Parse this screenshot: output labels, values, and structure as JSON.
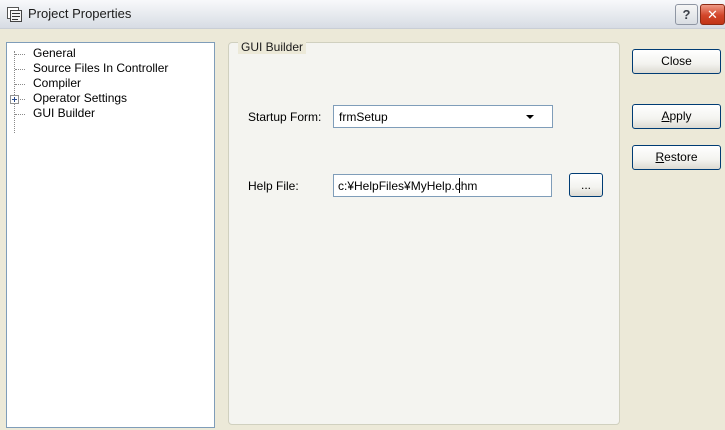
{
  "window": {
    "title": "Project Properties",
    "help_button": "?",
    "close_button": "✕",
    "icon": "properties-window-icon"
  },
  "tree": {
    "items": [
      {
        "label": "General"
      },
      {
        "label": "Source Files In Controller"
      },
      {
        "label": "Compiler"
      },
      {
        "label": "Operator Settings",
        "expander": "+"
      },
      {
        "label": "GUI Builder"
      }
    ]
  },
  "panel": {
    "title": "GUI Builder",
    "startup_form": {
      "label": "Startup Form:",
      "value": "frmSetup"
    },
    "help_file": {
      "label": "Help File:",
      "value": "c:¥HelpFiles¥MyHelp.chm",
      "browse_label": "..."
    }
  },
  "buttons": {
    "close": "Close",
    "apply": {
      "mnemonic": "A",
      "rest": "pply"
    },
    "restore": {
      "mnemonic": "R",
      "rest": "estore"
    }
  },
  "colors": {
    "dialog_bg": "#ece9d8",
    "input_border": "#7f9db9",
    "title_close_red": "#d2452a"
  }
}
